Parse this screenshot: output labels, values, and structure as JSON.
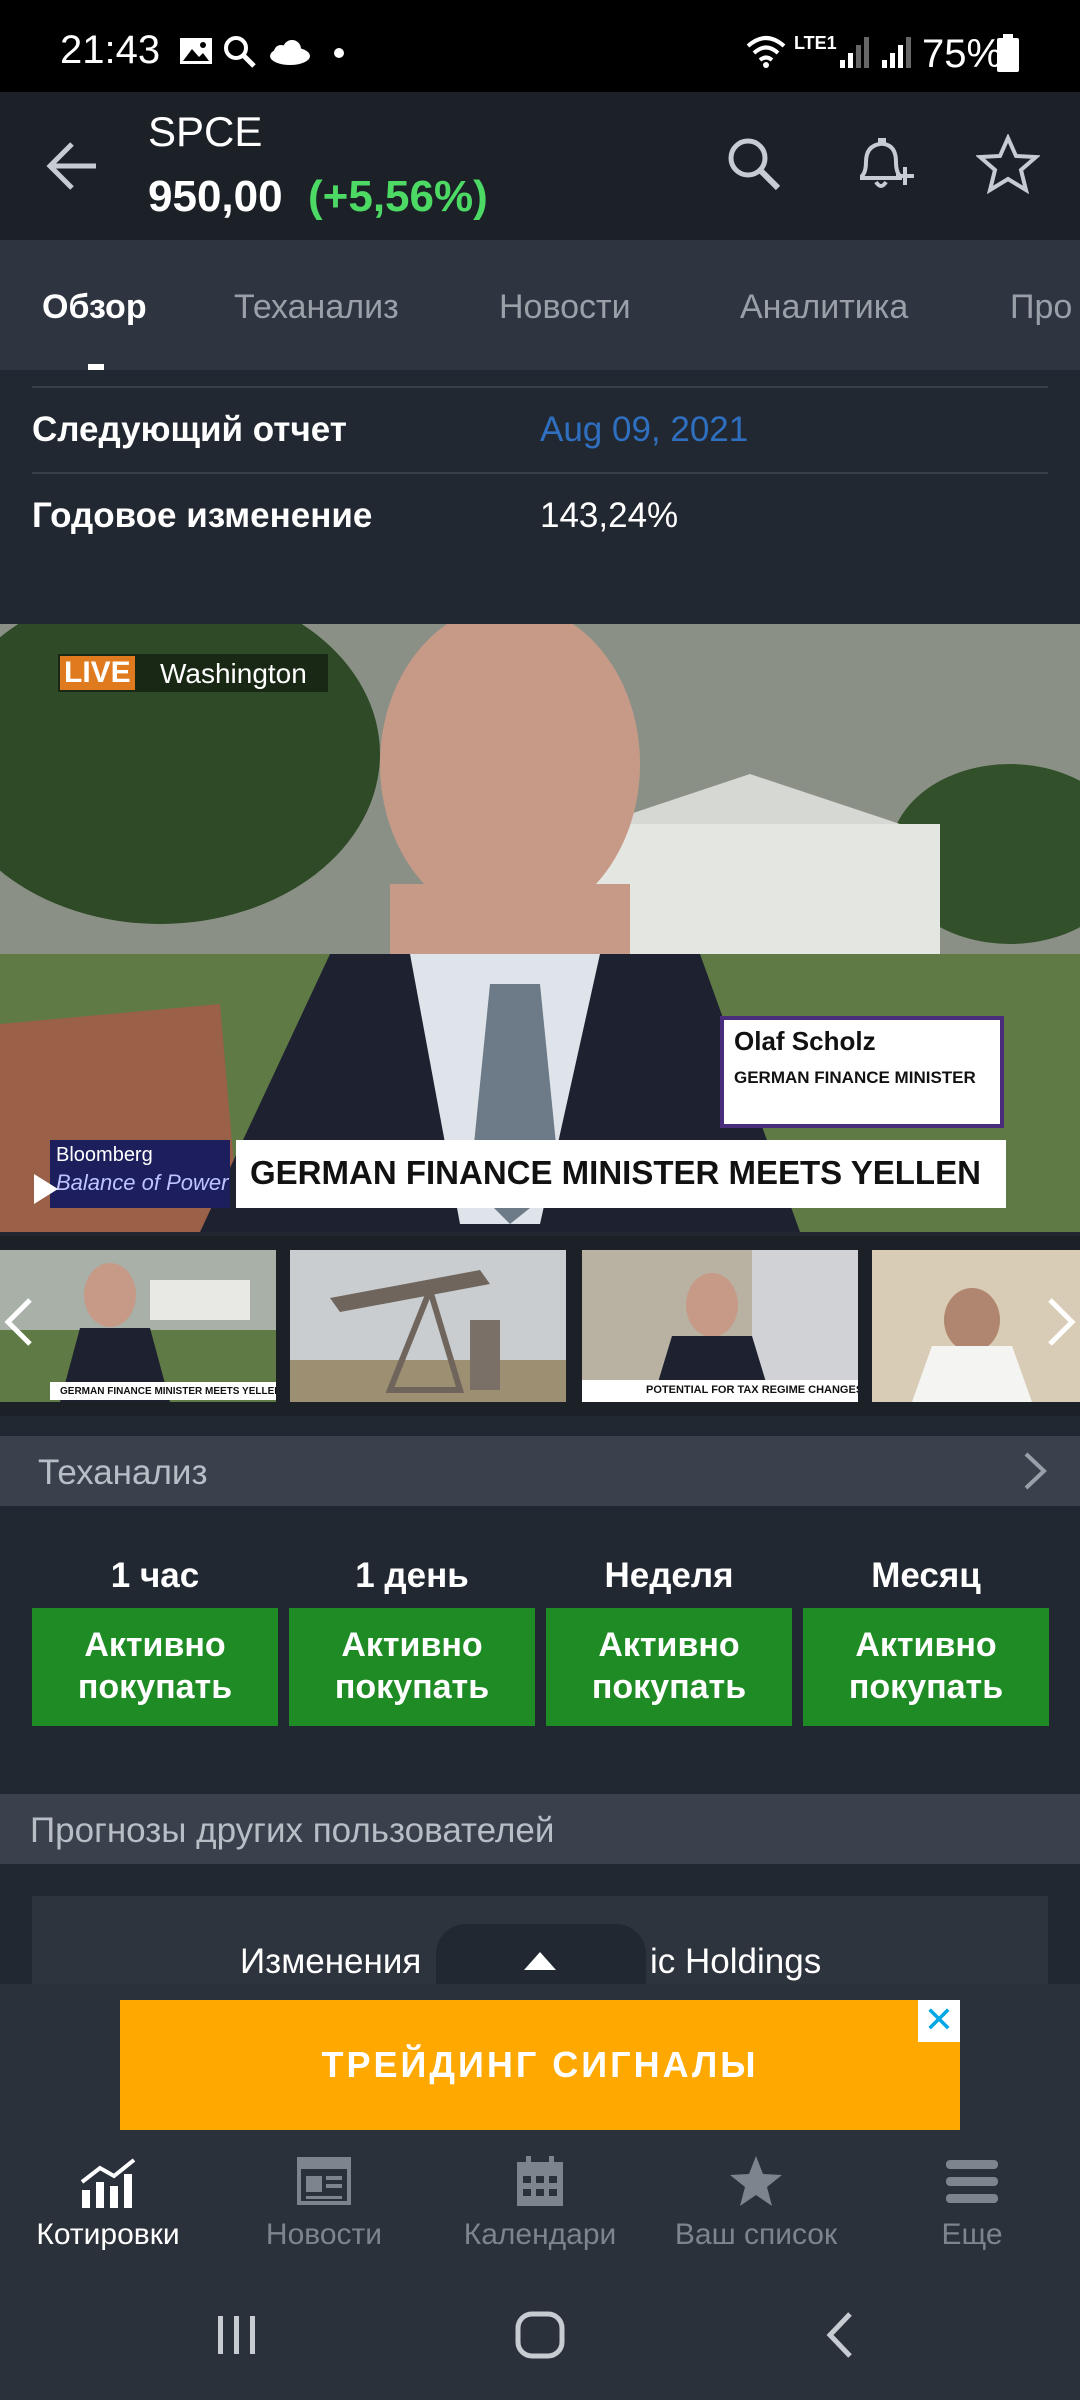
{
  "status_bar": {
    "time": "21:43",
    "network": "LTE1",
    "battery": "75%"
  },
  "header": {
    "ticker": "SPCE",
    "price": "950,00",
    "change": "(+5,56%)"
  },
  "tabs": [
    {
      "label": "Обзор",
      "active": true
    },
    {
      "label": "Теханализ",
      "active": false
    },
    {
      "label": "Новости",
      "active": false
    },
    {
      "label": "Аналитика",
      "active": false
    },
    {
      "label": "Про",
      "active": false
    }
  ],
  "overview": {
    "next_report_label": "Следующий отчет",
    "next_report_value": "Aug 09, 2021",
    "annual_change_label": "Годовое изменение",
    "annual_change_value": "143,24%"
  },
  "video": {
    "live_badge": "LIVE",
    "location": "Washington",
    "name_tag": "Olaf Scholz",
    "name_title": "GERMAN FINANCE MINISTER",
    "show_brand": "Bloomberg",
    "show_name": "Balance of Power",
    "headline": "GERMAN FINANCE MINISTER MEETS YELLEN"
  },
  "thumbnails": [
    {
      "caption": "GERMAN FINANCE MINISTER MEETS YELLEN"
    },
    {
      "caption": ""
    },
    {
      "caption": "POTENTIAL FOR TAX REGIME CHANGES"
    },
    {
      "caption": ""
    }
  ],
  "tech_analysis": {
    "title": "Теханализ",
    "periods": [
      {
        "label": "1 час",
        "signal_line1": "Активно",
        "signal_line2": "покупать"
      },
      {
        "label": "1 день",
        "signal_line1": "Активно",
        "signal_line2": "покупать"
      },
      {
        "label": "Неделя",
        "signal_line1": "Активно",
        "signal_line2": "покупать"
      },
      {
        "label": "Месяц",
        "signal_line1": "Активно",
        "signal_line2": "покупать"
      }
    ]
  },
  "forecasts": {
    "title": "Прогнозы других пользователей",
    "card_text_left": "Изменения",
    "card_text_right": "ic Holdings"
  },
  "ad": {
    "text": "ТРЕЙДИНГ СИГНАЛЫ",
    "close": "✕"
  },
  "bottom_nav": [
    {
      "label": "Котировки",
      "icon": "chart-icon",
      "active": true
    },
    {
      "label": "Новости",
      "icon": "news-icon",
      "active": false
    },
    {
      "label": "Календари",
      "icon": "calendar-icon",
      "active": false
    },
    {
      "label": "Ваш список",
      "icon": "star-icon",
      "active": false
    },
    {
      "label": "Еще",
      "icon": "menu-icon",
      "active": false
    }
  ],
  "colors": {
    "background": "#222831",
    "positive": "#4cd964",
    "buy_button": "#1f8b24",
    "link_blue": "#2f6fc0",
    "ad_orange": "#ffa800"
  }
}
